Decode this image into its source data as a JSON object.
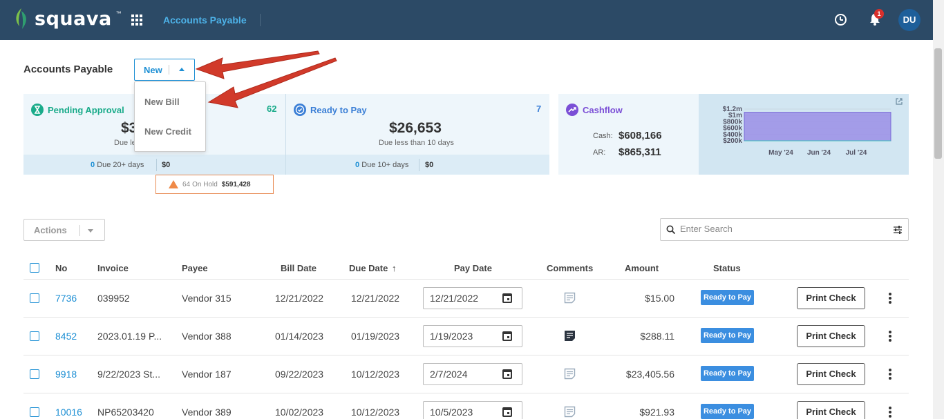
{
  "topbar": {
    "brand": "squava",
    "brand_mark": "™",
    "title": "Accounts Payable",
    "notification_count": "1",
    "avatar_initials": "DU",
    "colors": {
      "bg": "#2c4a66",
      "accent": "#4db2e8",
      "badge": "#d9302c",
      "avatar": "#1e5f9a"
    }
  },
  "page": {
    "title": "Accounts Payable",
    "new_button": "New",
    "new_menu": [
      "New Bill",
      "New Credit"
    ]
  },
  "cards": {
    "pending": {
      "title": "Pending Approval",
      "count": "62",
      "amount_partial": "$3",
      "sub_partial": "Due le",
      "foot_count": "0",
      "foot_label": "Due 20+ days",
      "foot_amount": "$0",
      "color": "#1aab8a"
    },
    "ready": {
      "title": "Ready to Pay",
      "count": "7",
      "amount": "$26,653",
      "sub": "Due less than 10 days",
      "foot_count": "0",
      "foot_label": "Due 10+ days",
      "foot_amount": "$0",
      "color": "#3b7fd6"
    },
    "onhold": {
      "count": "64",
      "label": "On Hold",
      "amount": "$591,428"
    },
    "cashflow": {
      "title": "Cashflow",
      "cash_label": "Cash:",
      "cash_value": "$608,166",
      "ar_label": "AR:",
      "ar_value": "$865,311",
      "color": "#7b4fd6"
    }
  },
  "chart_data": {
    "type": "area",
    "x": [
      "May '24",
      "Jun '24",
      "Jul '24"
    ],
    "series": [
      {
        "values": [
          1100000,
          1100000,
          1100000
        ]
      },
      {
        "values": [
          200000,
          200000,
          200000
        ]
      }
    ],
    "ytick_labels": [
      "$1.2m",
      "$1m",
      "$800k",
      "$600k",
      "$400k",
      "$200k"
    ],
    "ylim": [
      200000,
      1200000
    ]
  },
  "toolbar": {
    "actions_label": "Actions",
    "search_placeholder": "Enter Search"
  },
  "table": {
    "headers": {
      "no": "No",
      "invoice": "Invoice",
      "payee": "Payee",
      "bill_date": "Bill Date",
      "due_date": "Due Date",
      "due_sort": "↑",
      "pay_date": "Pay Date",
      "comments": "Comments",
      "amount": "Amount",
      "status": "Status"
    },
    "rows": [
      {
        "no": "7736",
        "invoice": "039952",
        "payee": "Vendor 315",
        "bill_date": "12/21/2022",
        "due_date": "12/21/2022",
        "pay_date": "12/21/2022",
        "has_comment": false,
        "amount": "$15.00",
        "status": "Ready to Pay",
        "action": "Print Check"
      },
      {
        "no": "8452",
        "invoice": "2023.01.19 P...",
        "payee": "Vendor 388",
        "bill_date": "01/14/2023",
        "due_date": "01/19/2023",
        "pay_date": "1/19/2023",
        "has_comment": true,
        "amount": "$288.11",
        "status": "Ready to Pay",
        "action": "Print Check"
      },
      {
        "no": "9918",
        "invoice": "9/22/2023 St...",
        "payee": "Vendor 187",
        "bill_date": "09/22/2023",
        "due_date": "10/12/2023",
        "pay_date": "2/7/2024",
        "has_comment": false,
        "amount": "$23,405.56",
        "status": "Ready to Pay",
        "action": "Print Check"
      },
      {
        "no": "10016",
        "invoice": "NP65203420",
        "payee": "Vendor 389",
        "bill_date": "10/02/2023",
        "due_date": "10/12/2023",
        "pay_date": "10/5/2023",
        "has_comment": false,
        "amount": "$921.93",
        "status": "Ready to Pay",
        "action": "Print Check"
      }
    ]
  }
}
